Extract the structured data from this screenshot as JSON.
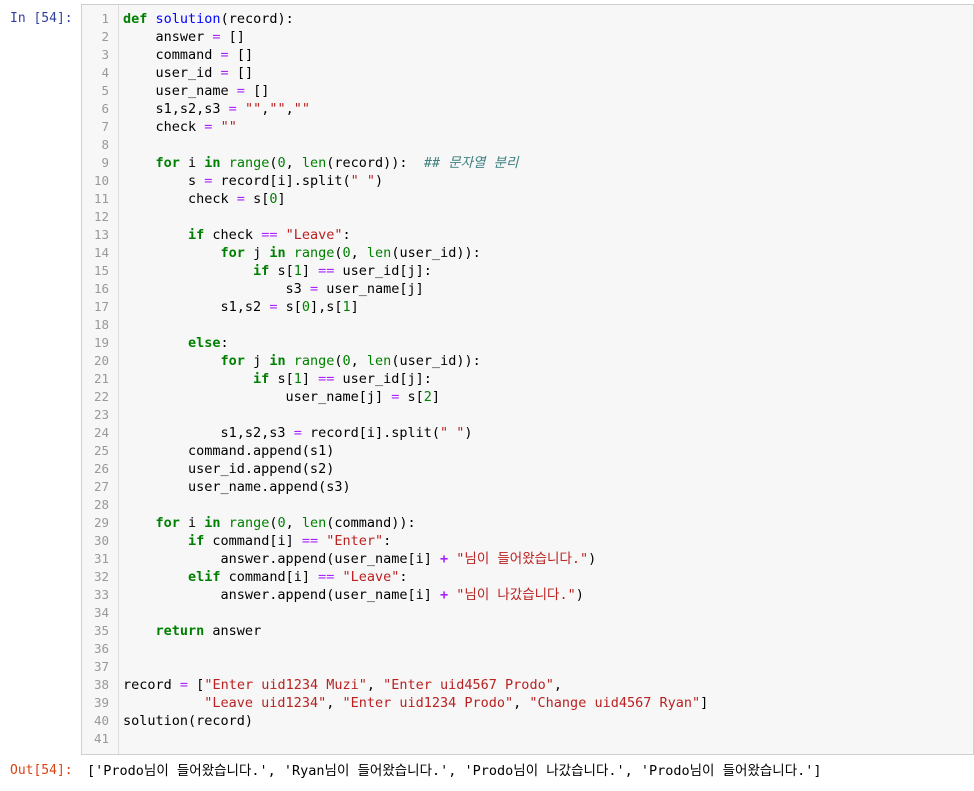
{
  "cell": {
    "in_prompt": "In [54]:",
    "out_prompt": "Out[54]:",
    "output_text": "['Prodo님이 들어왔습니다.', 'Ryan님이 들어왔습니다.', 'Prodo님이 나갔습니다.', 'Prodo님이 들어왔습니다.']"
  },
  "code": {
    "lines": [
      "def solution(record):",
      "    answer = []",
      "    command = []",
      "    user_id = []",
      "    user_name = []",
      "    s1,s2,s3 = \"\",\"\",\"\"",
      "    check = \"\"",
      "",
      "    for i in range(0, len(record)):  ## 문자열 분리",
      "        s = record[i].split(\" \")",
      "        check = s[0]",
      "",
      "        if check == \"Leave\":",
      "            for j in range(0, len(user_id)):",
      "                if s[1] == user_id[j]:",
      "                    s3 = user_name[j]",
      "            s1,s2 = s[0],s[1]",
      "",
      "        else:",
      "            for j in range(0, len(user_id)):",
      "                if s[1] == user_id[j]:",
      "                    user_name[j] = s[2]",
      "",
      "            s1,s2,s3 = record[i].split(\" \")",
      "        command.append(s1)",
      "        user_id.append(s2)",
      "        user_name.append(s3)",
      "",
      "    for i in range(0, len(command)):",
      "        if command[i] == \"Enter\":",
      "            answer.append(user_name[i] + \"님이 들어왔습니다.\")",
      "        elif command[i] == \"Leave\":",
      "            answer.append(user_name[i] + \"님이 나갔습니다.\")",
      "",
      "    return answer",
      "",
      "",
      "record = [\"Enter uid1234 Muzi\", \"Enter uid4567 Prodo\",",
      "          \"Leave uid1234\", \"Enter uid1234 Prodo\", \"Change uid4567 Ryan\"]",
      "solution(record)",
      ""
    ]
  }
}
